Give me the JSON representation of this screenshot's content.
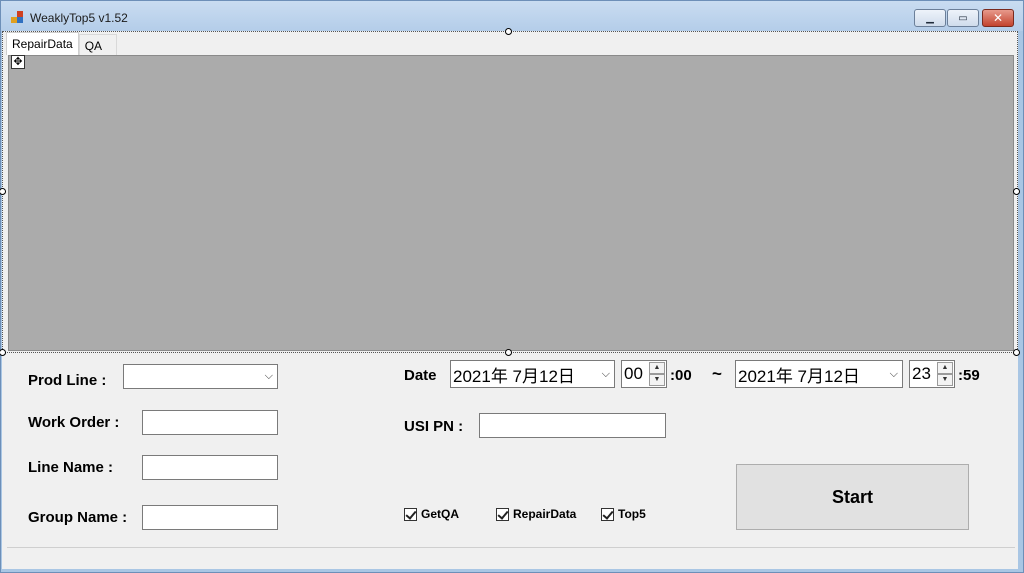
{
  "window": {
    "title": "WeaklyTop5 v1.52",
    "minimize": "▁",
    "maximize": "▭",
    "close": "✕"
  },
  "tabs": [
    {
      "label": "RepairData",
      "active": true
    },
    {
      "label": "QA",
      "active": false
    }
  ],
  "form": {
    "prod_line_label": "Prod Line :",
    "prod_line_value": "",
    "work_order_label": "Work Order :",
    "work_order_value": "",
    "line_name_label": "Line Name :",
    "line_name_value": "",
    "group_name_label": "Group Name :",
    "group_name_value": "",
    "date_label": "Date",
    "date_from": "2021年  7月12日",
    "hour_from": "00",
    "minute_from": ":00",
    "tilde": "~",
    "date_to": "2021年  7月12日",
    "hour_to": "23",
    "minute_to": ":59",
    "usi_pn_label": "USI PN :",
    "usi_pn_value": ""
  },
  "checkboxes": [
    {
      "label": "GetQA",
      "checked": true
    },
    {
      "label": "RepairData",
      "checked": true
    },
    {
      "label": "Top5",
      "checked": true
    }
  ],
  "start_label": "Start",
  "icons": {
    "chevron": "⌵",
    "spin_up": "▲",
    "spin_down": "▼",
    "move": "✥"
  }
}
